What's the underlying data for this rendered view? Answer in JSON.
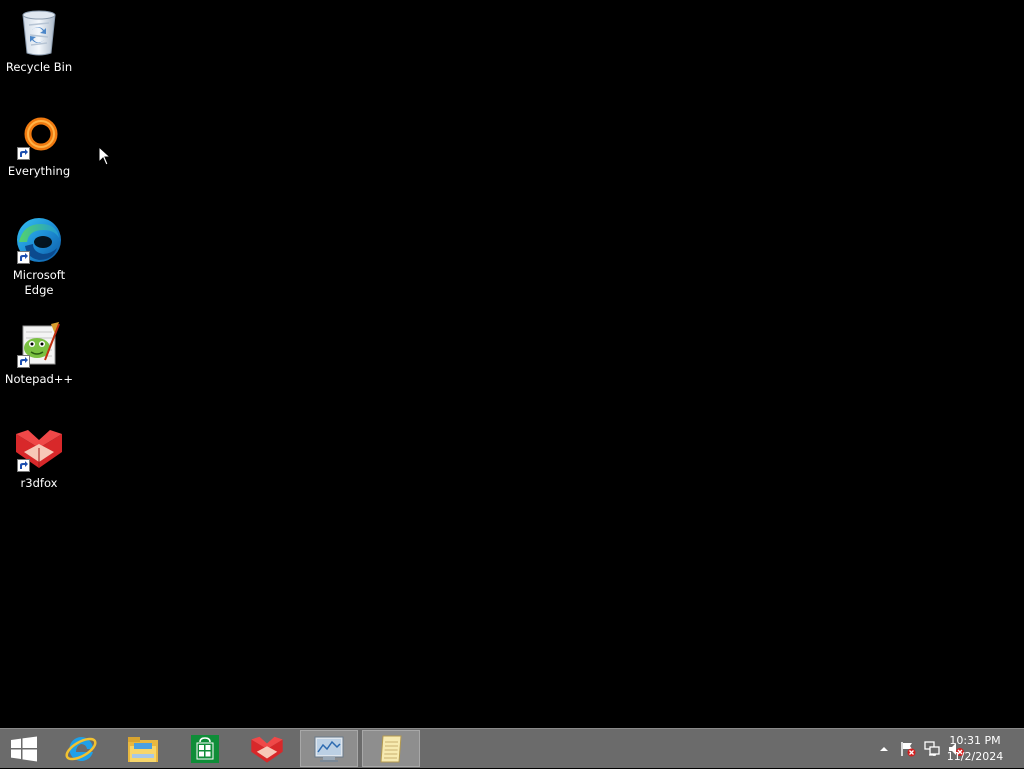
{
  "desktop": {
    "icons": [
      {
        "label": "Recycle Bin",
        "icon": "recycle-bin-icon"
      },
      {
        "label": "Everything",
        "icon": "everything-icon"
      },
      {
        "label": "Microsoft Edge",
        "icon": "edge-icon"
      },
      {
        "label": "Notepad++",
        "icon": "notepad-plus-plus-icon"
      },
      {
        "label": "r3dfox",
        "icon": "r3dfox-icon"
      }
    ]
  },
  "taskbar": {
    "start": {
      "icon": "windows-start-icon"
    },
    "items": [
      {
        "icon": "internet-explorer-icon",
        "active": false
      },
      {
        "icon": "file-explorer-icon",
        "active": false
      },
      {
        "icon": "store-icon",
        "active": false
      },
      {
        "icon": "r3dfox-icon",
        "active": false
      },
      {
        "icon": "resource-monitor-icon",
        "active": true
      },
      {
        "icon": "notepad-icon",
        "active": true
      }
    ],
    "tray": {
      "icons": [
        "show-hidden-icons-chevron",
        "action-center-flag-icon",
        "network-icon",
        "volume-muted-icon"
      ],
      "time": "10:31 PM",
      "date": "11/2/2024"
    }
  }
}
